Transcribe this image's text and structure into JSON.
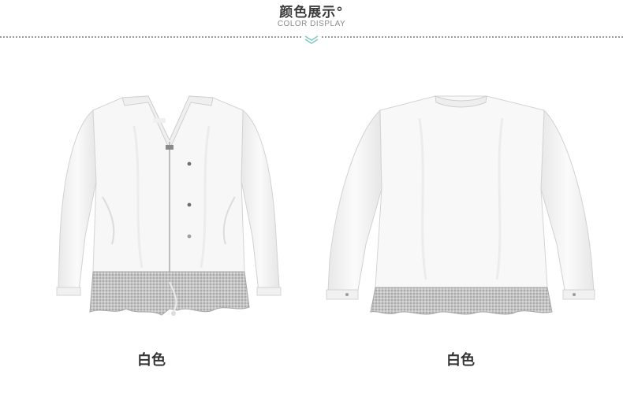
{
  "header": {
    "title": "颜色展示°",
    "subtitle": "COLOR DISPLAY"
  },
  "products": [
    {
      "caption": "白色",
      "view": "front"
    },
    {
      "caption": "白色",
      "view": "back"
    }
  ]
}
